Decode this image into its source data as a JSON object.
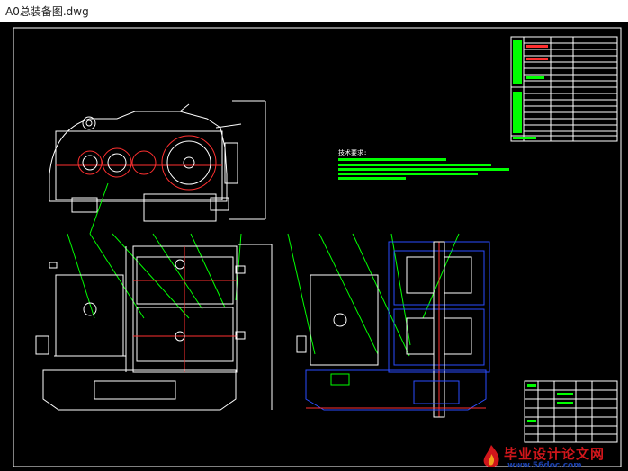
{
  "window": {
    "title": "A0总装备图.dwg"
  },
  "drawing": {
    "tech_notes_title": "技术要求:",
    "frame_color": "#ffffff",
    "line_color": "#ffffff",
    "center_color": "#ff3030",
    "note_color": "#00ff00",
    "section_color": "#2a4dff"
  },
  "watermark": {
    "text": "毕业设计论文网",
    "site": "www.56doc.com",
    "text_color": "#d0161b",
    "site_color": "#1a3fa8",
    "logo_icon": "flame-logo-icon"
  }
}
